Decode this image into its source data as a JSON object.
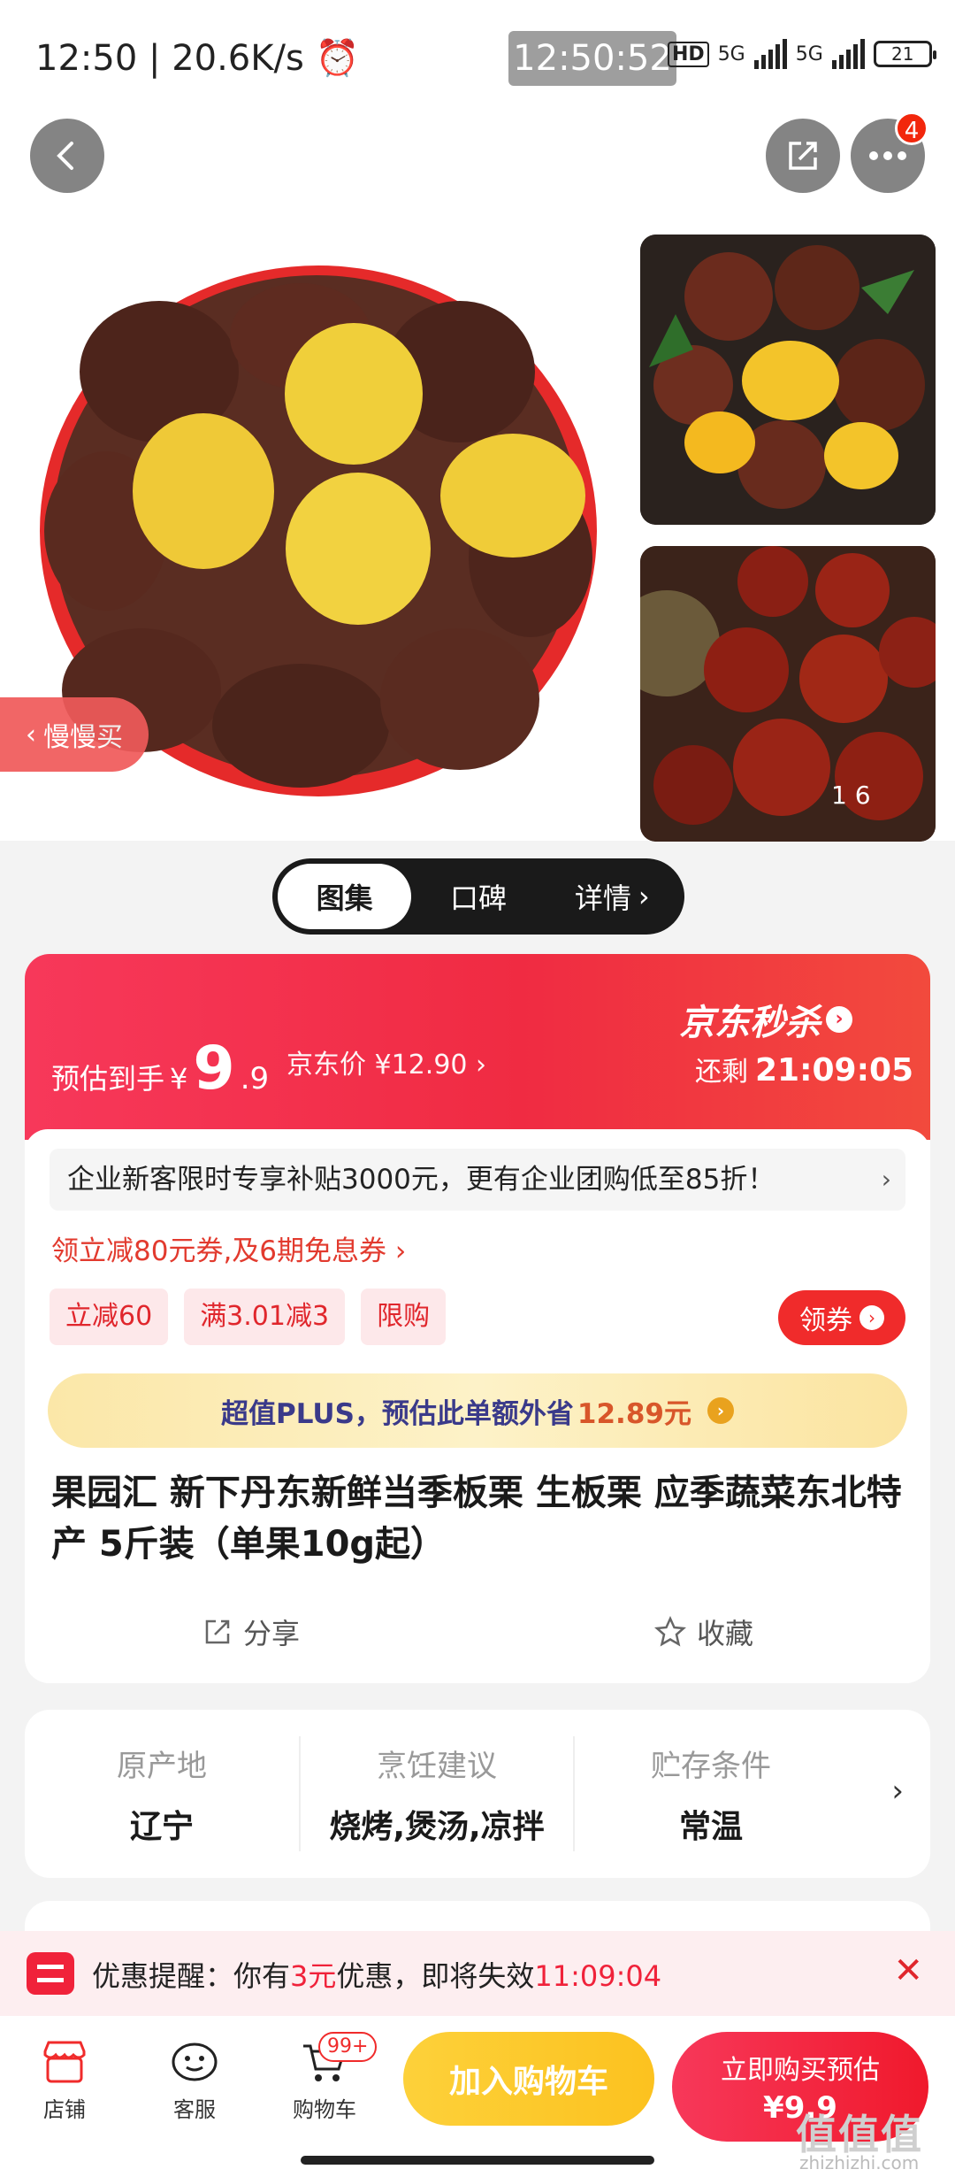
{
  "status_bar": {
    "time": "12:50",
    "net_speed": "| 20.6K/s",
    "overlay_clock": "12:50:52",
    "hd": "HD",
    "sig1": "5G",
    "sig2": "5G",
    "battery": "21"
  },
  "gallery": {
    "counter": "1    6",
    "slow_buy_label": "慢慢买"
  },
  "tabs": [
    {
      "label": "图集"
    },
    {
      "label": "口碑"
    },
    {
      "label": "详情"
    }
  ],
  "price": {
    "est_label": "预估到手",
    "currency": "¥",
    "est_integer": "9",
    "est_decimal": ".9",
    "jd_price": "京东价 ¥12.90",
    "flash_sale": "京东秒杀",
    "remaining_label": "还剩",
    "countdown": "21:09:05"
  },
  "promo": {
    "notice": "企业新客限时专享补贴3000元，更有企业团购低至85折！",
    "coupon_line": "领立减80元券,及6期免息券",
    "tags": [
      "立减60",
      "满3.01减3",
      "限购"
    ],
    "get_coupon": "领券",
    "plus_prefix": "超值PLUS，预估此单额外省",
    "plus_amount": "12.89元"
  },
  "product": {
    "title": "果园汇 新下丹东新鲜当季板栗 生板栗 应季蔬菜东北特产 5斤装（单果10g起）",
    "share": "分享",
    "favorite": "收藏"
  },
  "attributes": [
    {
      "key": "原产地",
      "value": "辽宁"
    },
    {
      "key": "烹饪建议",
      "value": "烧烤,煲汤,凉拌"
    },
    {
      "key": "贮存条件",
      "value": "常温"
    }
  ],
  "reminder": {
    "prefix": "优惠提醒：你有",
    "amount": "3元",
    "middle": "优惠，即将失效",
    "timer": "11:09:04"
  },
  "bottom_bar": {
    "store": "店铺",
    "service": "客服",
    "cart": "购物车",
    "cart_badge": "99+",
    "add_to_cart": "加入购物车",
    "buy_now": "立即购买预估",
    "buy_price": "¥9.9"
  },
  "watermark": {
    "main": "值值值",
    "sub": "zhizhizhi.com"
  },
  "colors": {
    "accent_red": "#f02b42",
    "cart_yellow": "#fcc21f",
    "plus_gold": "#fbe7a8"
  }
}
